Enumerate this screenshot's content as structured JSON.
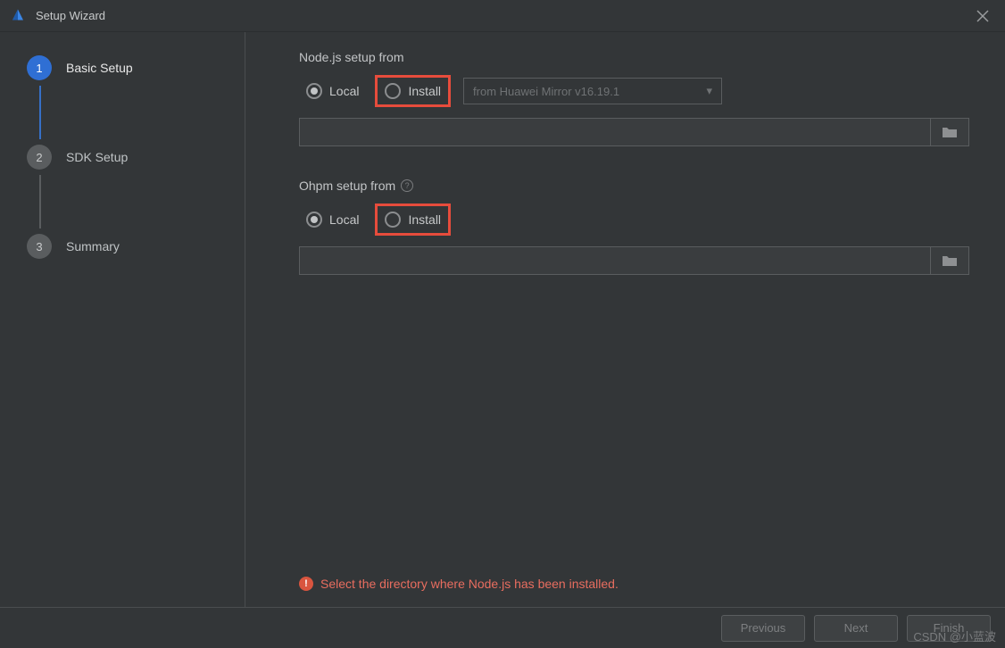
{
  "window": {
    "title": "Setup Wizard"
  },
  "sidebar": {
    "steps": [
      {
        "num": "1",
        "label": "Basic Setup",
        "active": true
      },
      {
        "num": "2",
        "label": "SDK Setup",
        "active": false
      },
      {
        "num": "3",
        "label": "Summary",
        "active": false
      }
    ]
  },
  "main": {
    "nodejs": {
      "section_label": "Node.js setup from",
      "radio_local": "Local",
      "radio_install": "Install",
      "selected": "local",
      "dropdown_text": "from Huawei Mirror v16.19.1",
      "path_value": ""
    },
    "ohpm": {
      "section_label": "Ohpm setup from",
      "radio_local": "Local",
      "radio_install": "Install",
      "selected": "local",
      "path_value": ""
    },
    "error_text": "Select the directory where Node.js has been installed."
  },
  "footer": {
    "previous": "Previous",
    "next": "Next",
    "finish": "Finish"
  },
  "watermark": "CSDN @小蓝波"
}
